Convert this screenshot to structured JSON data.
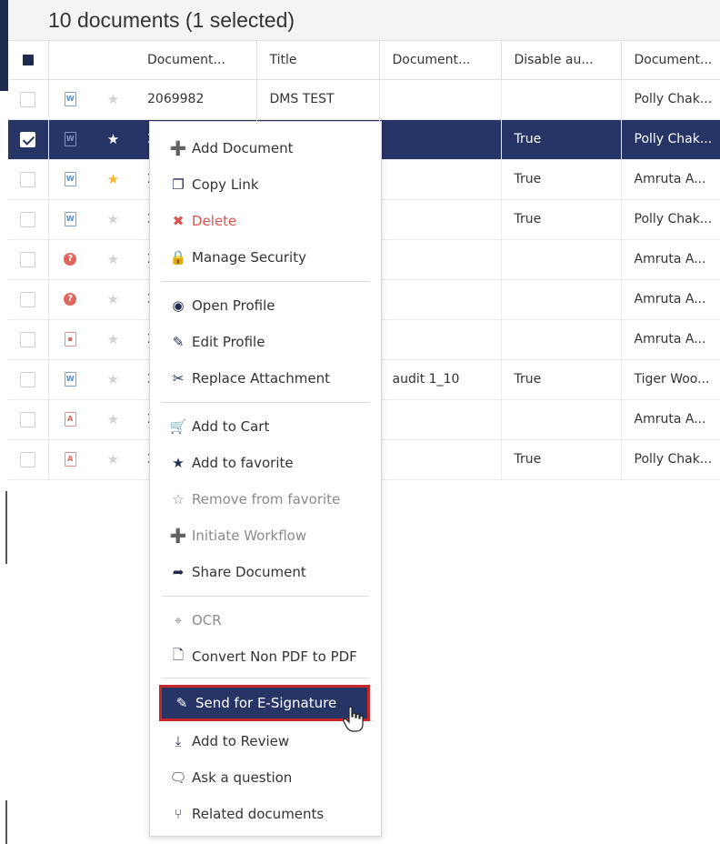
{
  "header": {
    "title": "10 documents (1 selected)"
  },
  "columns": [
    "Document...",
    "Title",
    "Document...",
    "Disable au...",
    "Document..."
  ],
  "rows": [
    {
      "icon": "word-file-icon",
      "starred": false,
      "selected": false,
      "doc_no": "2069982",
      "title": "DMS TEST",
      "doc_type": "",
      "disable": "",
      "author": "Polly Chak..."
    },
    {
      "icon": "word-file-icon",
      "starred": true,
      "selected": true,
      "doc_no": "2",
      "title": "",
      "doc_type": "",
      "disable": "True",
      "author": "Polly Chak..."
    },
    {
      "icon": "word-file-icon",
      "starred": true,
      "selected": false,
      "doc_no": "2",
      "title": "",
      "doc_type": "",
      "disable": "True",
      "author": "Amruta A..."
    },
    {
      "icon": "word-file-icon",
      "starred": false,
      "selected": false,
      "doc_no": "2",
      "title": "",
      "doc_type": "",
      "disable": "True",
      "author": "Polly Chak..."
    },
    {
      "icon": "unknown-file-icon",
      "starred": false,
      "selected": false,
      "doc_no": "2",
      "title": "",
      "doc_type": "",
      "disable": "",
      "author": "Amruta A..."
    },
    {
      "icon": "unknown-file-icon",
      "starred": false,
      "selected": false,
      "doc_no": "2",
      "title": "",
      "doc_type": "",
      "disable": "",
      "author": "Amruta A..."
    },
    {
      "icon": "image-file-icon",
      "starred": false,
      "selected": false,
      "doc_no": "2",
      "title": "",
      "doc_type": "",
      "disable": "",
      "author": "Amruta A..."
    },
    {
      "icon": "word-file-icon",
      "starred": false,
      "selected": false,
      "doc_no": "2",
      "title": "",
      "doc_type": "audit 1_10",
      "disable": "True",
      "author": "Tiger Woo..."
    },
    {
      "icon": "pdf-file-icon",
      "starred": false,
      "selected": false,
      "doc_no": "2",
      "title": "",
      "doc_type": "",
      "disable": "",
      "author": "Amruta A..."
    },
    {
      "icon": "pdf-file-icon",
      "starred": false,
      "selected": false,
      "doc_no": "2",
      "title": "",
      "doc_type": "",
      "disable": "True",
      "author": "Polly Chak..."
    }
  ],
  "menu": {
    "add_document": "Add Document",
    "copy_link": "Copy Link",
    "delete": "Delete",
    "manage_security": "Manage Security",
    "open_profile": "Open Profile",
    "edit_profile": "Edit Profile",
    "replace_attachment": "Replace Attachment",
    "add_to_cart": "Add to Cart",
    "add_to_favorite": "Add to favorite",
    "remove_from_favorite": "Remove from favorite",
    "initiate_workflow": "Initiate Workflow",
    "share_document": "Share Document",
    "ocr": "OCR",
    "convert_pdf": "Convert Non PDF to PDF",
    "send_esignature": "Send for E-Signature",
    "add_to_review": "Add to Review",
    "ask_question": "Ask a question",
    "related_documents": "Related documents"
  },
  "colors": {
    "selected_row": "#273466",
    "accent": "#1f2a4f",
    "danger": "#d9534f",
    "highlight_border": "#c62828",
    "star_gold": "#f2b632"
  }
}
